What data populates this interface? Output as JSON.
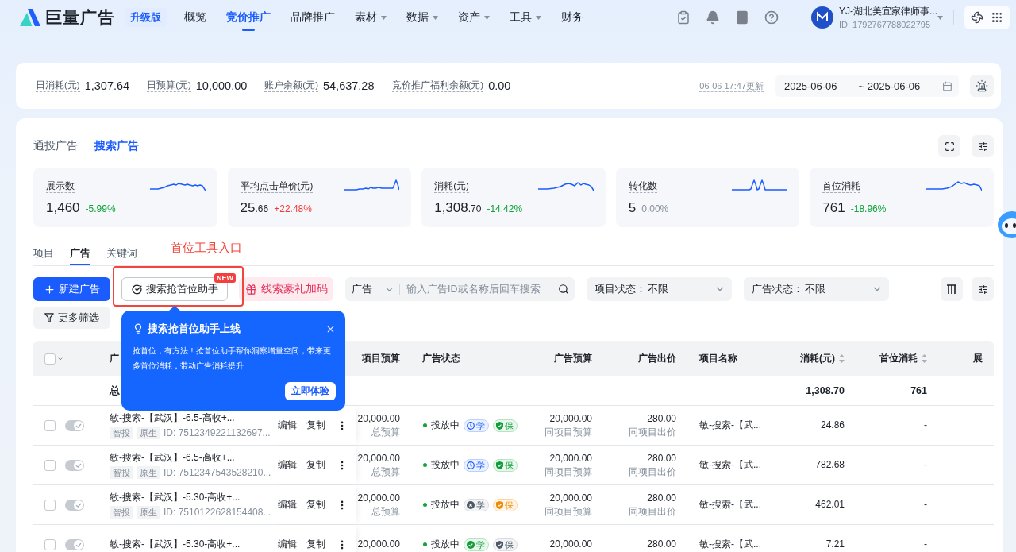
{
  "nav": {
    "logo_text": "巨量广告",
    "edition": "升级版",
    "items": [
      {
        "label": "概览",
        "selected": false,
        "dropdown": false
      },
      {
        "label": "竞价推广",
        "selected": true,
        "dropdown": false
      },
      {
        "label": "品牌推广",
        "selected": false,
        "dropdown": false
      },
      {
        "label": "素材",
        "selected": false,
        "dropdown": true
      },
      {
        "label": "数据",
        "selected": false,
        "dropdown": true
      },
      {
        "label": "资产",
        "selected": false,
        "dropdown": true
      },
      {
        "label": "工具",
        "selected": false,
        "dropdown": true
      },
      {
        "label": "财务",
        "selected": false,
        "dropdown": false
      }
    ],
    "account": {
      "name": "YJ-湖北美宜家律师事...",
      "id": "ID: 1792767788022795"
    }
  },
  "summary": {
    "stats": [
      {
        "label": "日消耗(元)",
        "value": "1,307.64"
      },
      {
        "label": "日预算(元)",
        "value": "10,000.00"
      },
      {
        "label": "账户余额(元)",
        "value": "54,637.28"
      },
      {
        "label": "竞价推广福利余额(元)",
        "value": "0.00"
      }
    ],
    "updated": "06-06 17:47更新",
    "date_start": "2025-06-06",
    "date_end": "~ 2025-06-06"
  },
  "ad_type_tabs": [
    {
      "label": "通投广告",
      "selected": false
    },
    {
      "label": "搜索广告",
      "selected": true
    }
  ],
  "metrics": [
    {
      "label": "展示数",
      "value": "1,460",
      "change": "-5.99%",
      "color": "#0fa23a"
    },
    {
      "label": "平均点击单价(元)",
      "value": "25.66",
      "change": "+22.48%",
      "color": "#f23c3c"
    },
    {
      "label": "消耗(元)",
      "value": "1,308.70",
      "change": "-14.42%",
      "color": "#0fa23a"
    },
    {
      "label": "转化数",
      "value": "5",
      "change": "0.00%",
      "color": "#86909c"
    },
    {
      "label": "首位消耗",
      "value": "761",
      "change": "-18.96%",
      "color": "#0fa23a"
    }
  ],
  "sub_tabs": [
    {
      "label": "项目",
      "selected": false
    },
    {
      "label": "广告",
      "selected": true
    },
    {
      "label": "关键词",
      "selected": false
    }
  ],
  "annotation": {
    "label": "首位工具入口"
  },
  "toolbar": {
    "new_button": "新建广告",
    "assistant_button": "搜索抢首位助手",
    "assistant_badge": "NEW",
    "promo_button": "线索豪礼加码",
    "search_scope": "广告",
    "search_placeholder": "输入广告ID或名称后回车搜索",
    "filters": [
      {
        "label": "项目状态：",
        "value": "不限"
      },
      {
        "label": "广告状态：",
        "value": "不限"
      }
    ],
    "more_filters": "更多筛选"
  },
  "popover": {
    "title": "搜索抢首位助手上线",
    "body": "抢首位，有方法！抢首位助手帮你洞察增量空间，带来更多首位消耗，带动广告消耗提升",
    "action": "立即体验"
  },
  "table": {
    "header_checked": false,
    "columns": [
      {
        "label": "广"
      },
      {
        "label": "项目预算",
        "sortable": false
      },
      {
        "label": "广告状态",
        "sortable": false
      },
      {
        "label": "广告预算",
        "sortable": false
      },
      {
        "label": "广告出价",
        "sortable": false
      },
      {
        "label": "项目名称",
        "sortable": false
      },
      {
        "label": "消耗(元)",
        "sortable": true
      },
      {
        "label": "首位消耗",
        "sortable": true
      },
      {
        "label": "展"
      }
    ],
    "summary": {
      "label": "总",
      "spend": "1,308.70",
      "top_spend": "761"
    },
    "rows": [
      {
        "checked": false,
        "on": true,
        "name": "敏-搜索-【武汉】-6.5-高收+...",
        "tags": [
          "智投",
          "原生"
        ],
        "id": "ID: 7512349221132697...",
        "actions": [
          "编辑",
          "复制"
        ],
        "project_budget": "20,000.00",
        "project_budget_note": "总预算",
        "status": "投放中",
        "learn": {
          "label": "学",
          "kind": "learning"
        },
        "guarantee": {
          "label": "保",
          "kind": "ok"
        },
        "ad_budget": "20,000.00",
        "ad_budget_note": "同项目预算",
        "bid": "280.00",
        "bid_note": "同项目出价",
        "project_name": "敏-搜索-【武...",
        "spend": "24.86",
        "top_spend": "-"
      },
      {
        "checked": false,
        "on": true,
        "name": "敏-搜索-【武汉】-6.5-高收+...",
        "tags": [
          "智投",
          "原生"
        ],
        "id": "ID: 7512347543528210...",
        "actions": [
          "编辑",
          "复制"
        ],
        "project_budget": "20,000.00",
        "project_budget_note": "总预算",
        "status": "投放中",
        "learn": {
          "label": "学",
          "kind": "learning"
        },
        "guarantee": {
          "label": "保",
          "kind": "ok"
        },
        "ad_budget": "20,000.00",
        "ad_budget_note": "同项目预算",
        "bid": "280.00",
        "bid_note": "同项目出价",
        "project_name": "敏-搜索-【武...",
        "spend": "782.68",
        "top_spend": "-"
      },
      {
        "checked": false,
        "on": true,
        "name": "敏-搜索-【武汉】-5.30-高收+...",
        "tags": [
          "智投",
          "原生"
        ],
        "id": "ID: 7510122628154408...",
        "actions": [
          "编辑",
          "复制"
        ],
        "project_budget": "20,000.00",
        "project_budget_note": "总预算",
        "status": "投放中",
        "learn": {
          "label": "学",
          "kind": "failed"
        },
        "guarantee": {
          "label": "保",
          "kind": "warning"
        },
        "ad_budget": "20,000.00",
        "ad_budget_note": "同项目预算",
        "bid": "280.00",
        "bid_note": "同项目出价",
        "project_name": "敏-搜索-【武...",
        "spend": "462.01",
        "top_spend": "-"
      },
      {
        "checked": false,
        "on": true,
        "name": "敏-搜索-【武汉】-5.30-高收+...",
        "actions": [
          "编辑",
          "复制"
        ],
        "project_budget": "20,000.00",
        "status": "投放中",
        "learn": {
          "label": "学",
          "kind": "success"
        },
        "guarantee": {
          "label": "保",
          "kind": "none"
        },
        "ad_budget": "20,000.00",
        "bid": "280.00",
        "project_name": "敏-搜索-【武...",
        "spend": "7.21",
        "top_spend": "-"
      }
    ]
  }
}
